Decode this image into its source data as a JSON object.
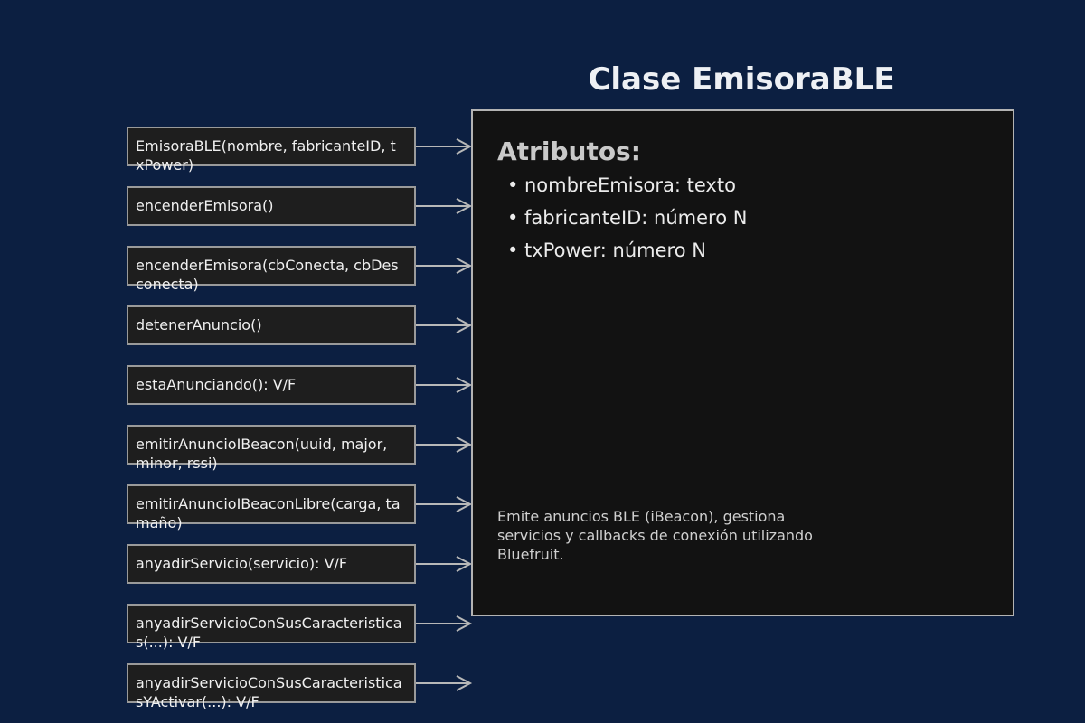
{
  "title": "Clase EmisoraBLE",
  "class_box": {
    "attributes_heading": "Atributos:",
    "attributes": [
      "nombreEmisora: texto",
      "fabricanteID: número N",
      "txPower: número N"
    ],
    "description": "Emite anuncios BLE (iBeacon), gestiona servicios y callbacks de conexión utilizando Bluefruit."
  },
  "methods": [
    "EmisoraBLE(nombre, fabricanteID, txPower)",
    "encenderEmisora()",
    "encenderEmisora(cbConecta, cbDesconecta)",
    "detenerAnuncio()",
    "estaAnunciando(): V/F",
    "emitirAnuncioIBeacon(uuid, major, minor, rssi)",
    "emitirAnuncioIBeaconLibre(carga, tamaño)",
    "anyadirServicio(servicio): V/F",
    "anyadirServicioConSusCaracteristicas(...): V/F",
    "anyadirServicioConSusCaracteristicasYActivar(...): V/F"
  ],
  "colors": {
    "background": "#0c1f41",
    "box_fill": "#121212",
    "method_fill": "#1e1e1e",
    "border": "#b3b3b3",
    "arrow": "#b8b8b8"
  }
}
